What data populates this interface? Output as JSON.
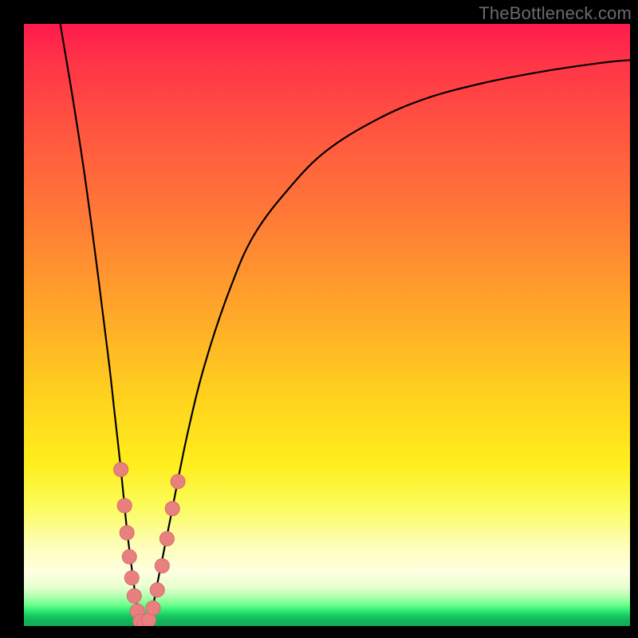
{
  "watermark": "TheBottleneck.com",
  "colors": {
    "frame_bg": "#000000",
    "curve_stroke": "#000000",
    "marker_fill": "#e98080",
    "marker_stroke": "#d86a6a",
    "gradient_top": "#ff1a4d",
    "gradient_bottom": "#12aa56"
  },
  "chart_data": {
    "type": "line",
    "title": "",
    "xlabel": "",
    "ylabel": "",
    "xlim": [
      0,
      100
    ],
    "ylim": [
      0,
      100
    ],
    "grid": false,
    "legend": false,
    "series": [
      {
        "name": "bottleneck-curve",
        "x": [
          6,
          8,
          10,
          12,
          14,
          15,
          16,
          17,
          18,
          18.7,
          19.3,
          20,
          21,
          22,
          24,
          27,
          30,
          34,
          38,
          44,
          50,
          58,
          66,
          75,
          85,
          95,
          100
        ],
        "y": [
          100,
          88,
          75,
          60,
          44,
          35,
          26,
          16,
          8,
          3,
          0.5,
          0,
          2,
          7,
          17,
          32,
          44,
          56,
          65,
          73,
          79,
          84,
          87.5,
          90,
          92,
          93.5,
          94
        ]
      }
    ],
    "markers": [
      {
        "x": 16.0,
        "y": 26.0
      },
      {
        "x": 16.6,
        "y": 20.0
      },
      {
        "x": 17.0,
        "y": 15.5
      },
      {
        "x": 17.4,
        "y": 11.5
      },
      {
        "x": 17.8,
        "y": 8.0
      },
      {
        "x": 18.2,
        "y": 5.0
      },
      {
        "x": 18.7,
        "y": 2.5
      },
      {
        "x": 19.2,
        "y": 0.8
      },
      {
        "x": 19.8,
        "y": 0.2
      },
      {
        "x": 20.6,
        "y": 1.0
      },
      {
        "x": 21.3,
        "y": 3.0
      },
      {
        "x": 22.0,
        "y": 6.0
      },
      {
        "x": 22.8,
        "y": 10.0
      },
      {
        "x": 23.6,
        "y": 14.5
      },
      {
        "x": 24.5,
        "y": 19.5
      },
      {
        "x": 25.4,
        "y": 24.0
      }
    ]
  }
}
